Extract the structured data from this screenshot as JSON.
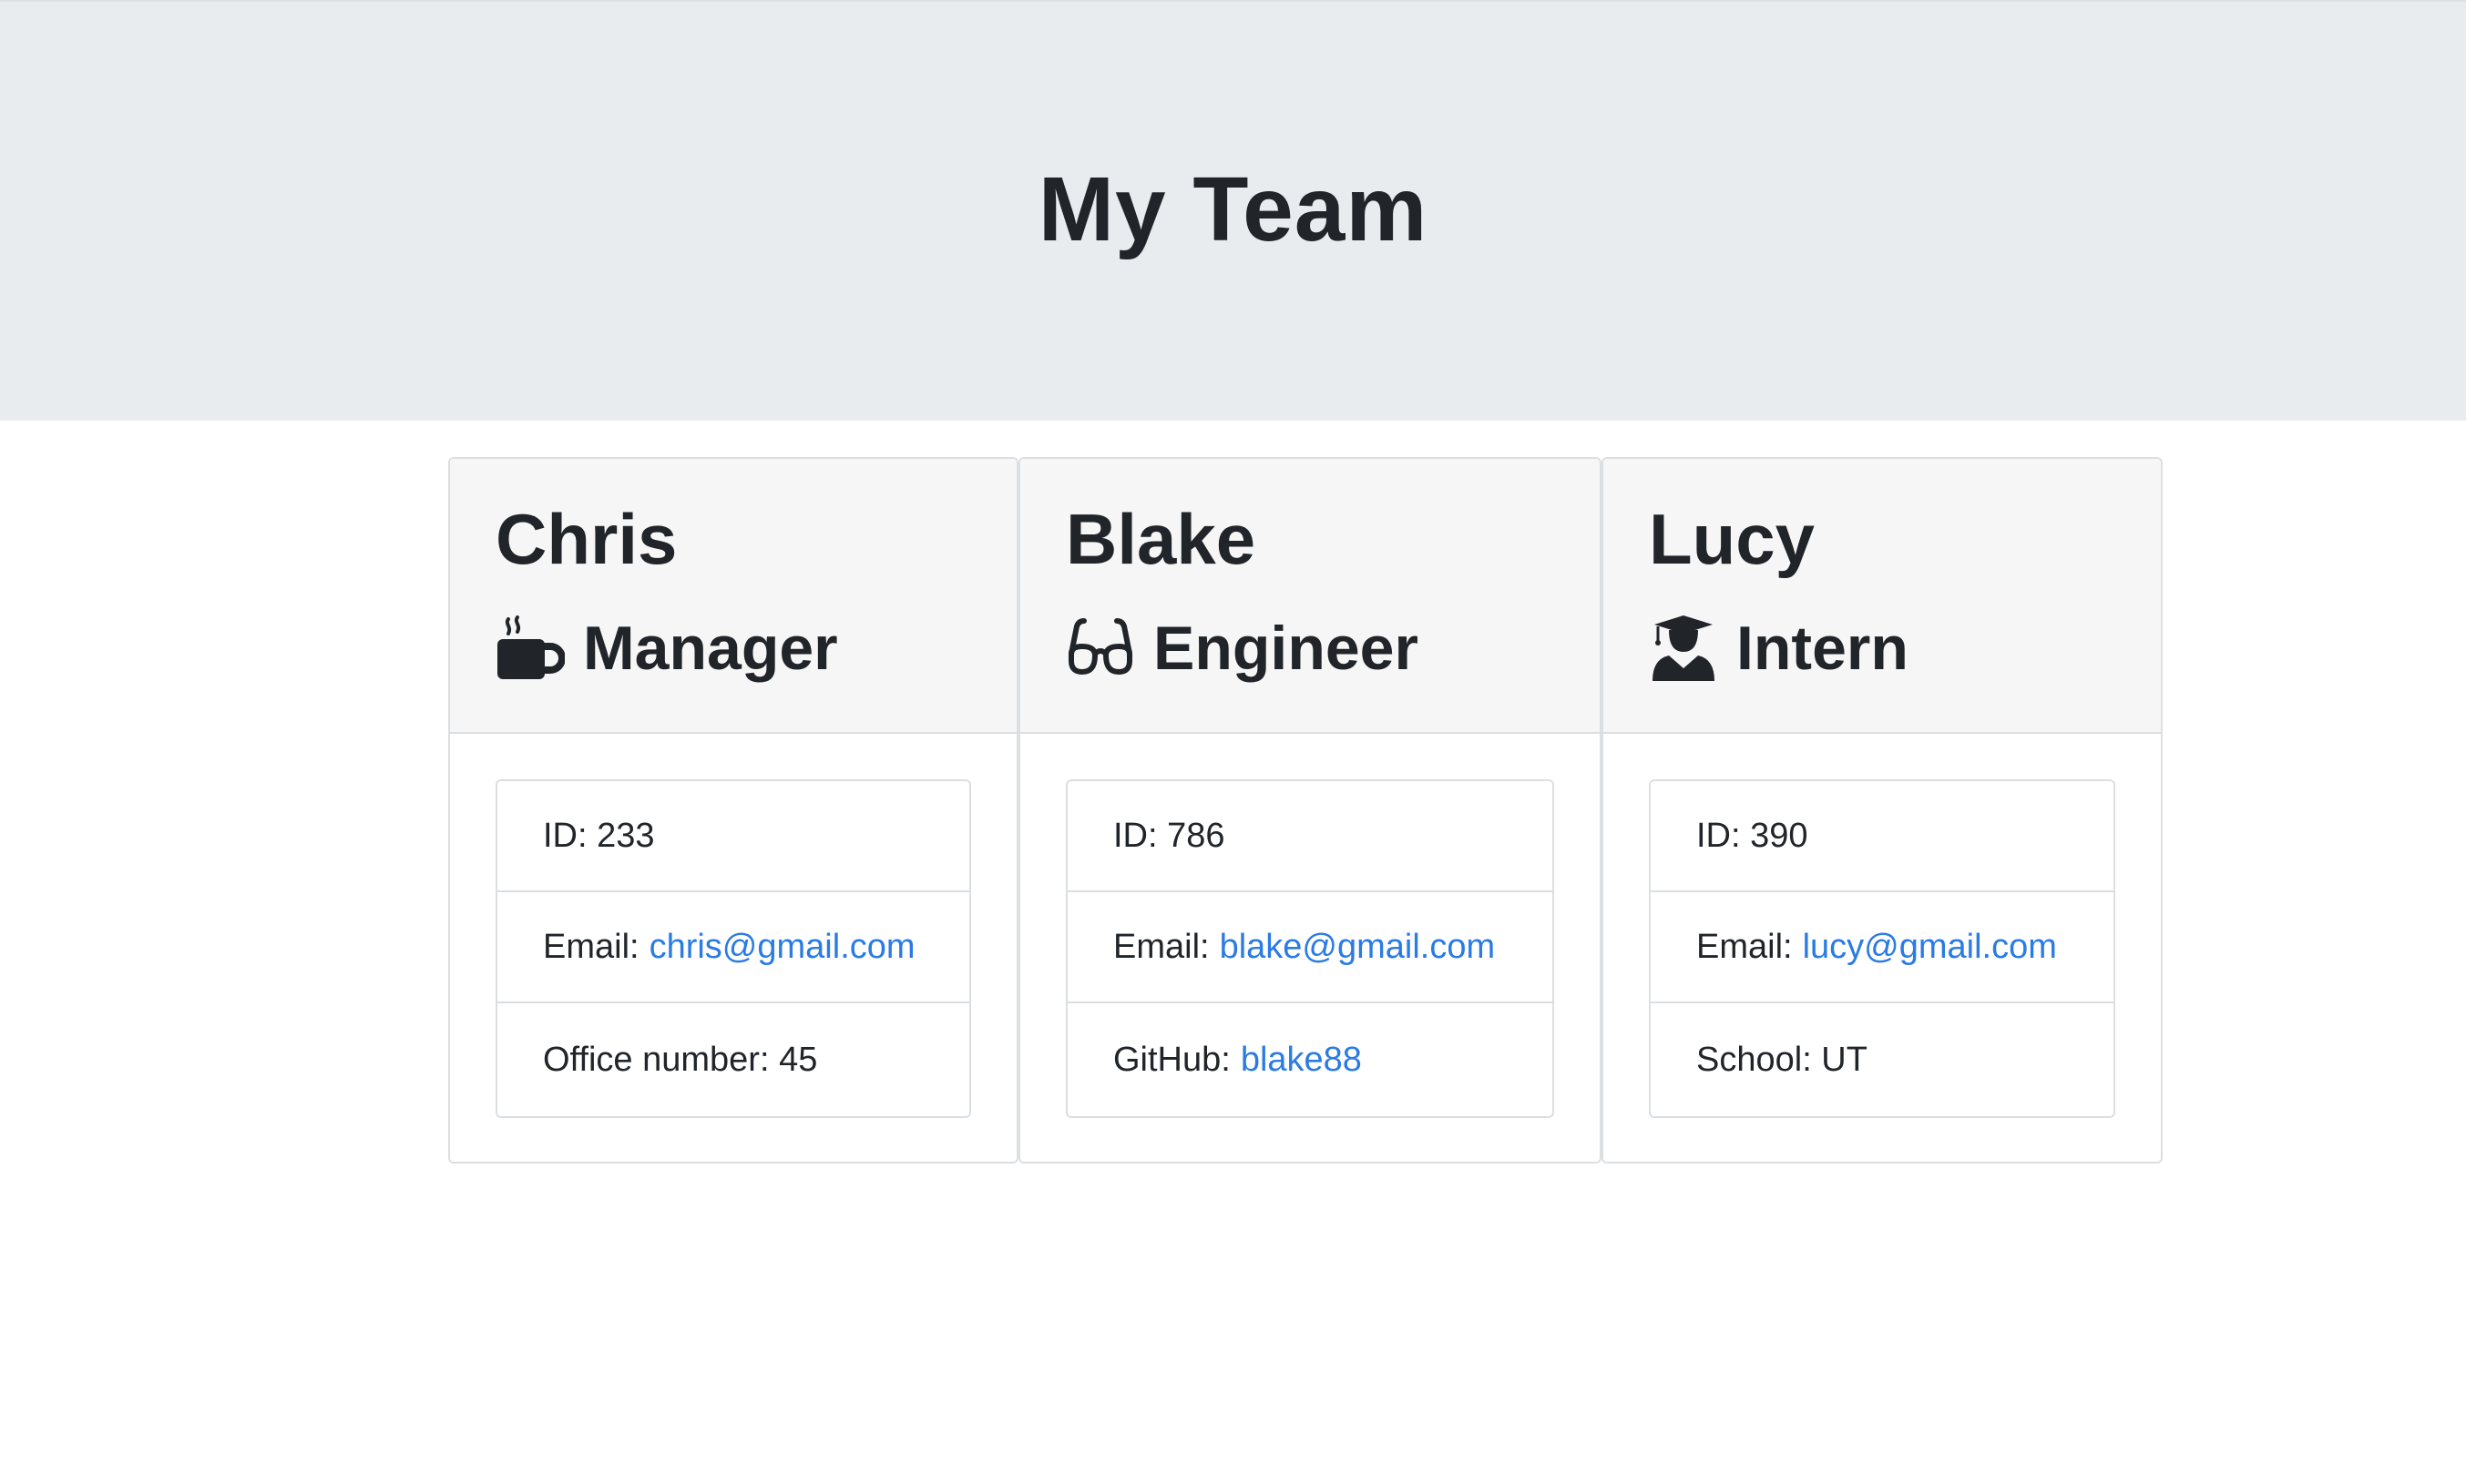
{
  "header": {
    "title": "My Team"
  },
  "team": [
    {
      "name": "Chris",
      "role": "Manager",
      "role_icon": "mug-hot-icon",
      "id_label": "ID: 233",
      "email_label": "Email:",
      "email": "chris@gmail.com",
      "extra_label": "Office number: 45",
      "extra_link": ""
    },
    {
      "name": "Blake",
      "role": "Engineer",
      "role_icon": "glasses-icon",
      "id_label": "ID: 786",
      "email_label": "Email:",
      "email": "blake@gmail.com",
      "extra_label": "GitHub:",
      "extra_link": "blake88"
    },
    {
      "name": "Lucy",
      "role": "Intern",
      "role_icon": "user-graduate-icon",
      "id_label": "ID: 390",
      "email_label": "Email:",
      "email": "lucy@gmail.com",
      "extra_label": "School: UT",
      "extra_link": ""
    }
  ],
  "colors": {
    "header_bg": "#e9ecef",
    "card_header_bg": "#f6f6f6",
    "link": "#2a7be4",
    "text": "#212529"
  }
}
